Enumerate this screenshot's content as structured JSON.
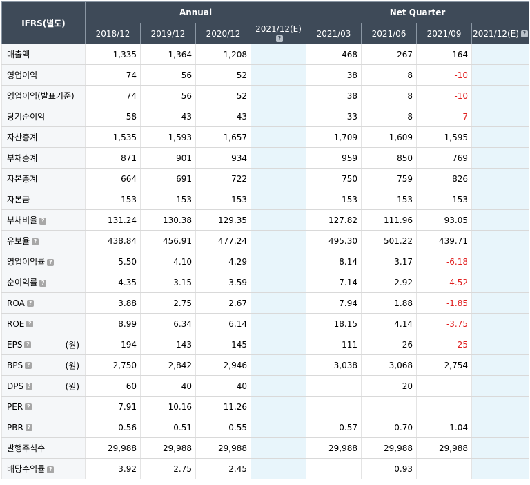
{
  "header": {
    "corner": "IFRS(별도)",
    "groups": [
      "Annual",
      "Net Quarter"
    ],
    "periods": [
      "2018/12",
      "2019/12",
      "2020/12",
      "2021/12(E)",
      "2021/03",
      "2021/06",
      "2021/09",
      "2021/12(E)"
    ],
    "help_glyph": "?"
  },
  "rows": [
    {
      "label": "매출액",
      "help": false,
      "unit": "",
      "values": [
        "1,335",
        "1,364",
        "1,208",
        "",
        "468",
        "267",
        "164",
        ""
      ]
    },
    {
      "label": "영업이익",
      "help": false,
      "unit": "",
      "values": [
        "74",
        "56",
        "52",
        "",
        "38",
        "8",
        "-10",
        ""
      ]
    },
    {
      "label": "영업이익(발표기준)",
      "help": false,
      "unit": "",
      "values": [
        "74",
        "56",
        "52",
        "",
        "38",
        "8",
        "-10",
        ""
      ]
    },
    {
      "label": "당기순이익",
      "help": false,
      "unit": "",
      "values": [
        "58",
        "43",
        "43",
        "",
        "33",
        "8",
        "-7",
        ""
      ]
    },
    {
      "label": "자산총계",
      "help": false,
      "unit": "",
      "values": [
        "1,535",
        "1,593",
        "1,657",
        "",
        "1,709",
        "1,609",
        "1,595",
        ""
      ]
    },
    {
      "label": "부채총계",
      "help": false,
      "unit": "",
      "values": [
        "871",
        "901",
        "934",
        "",
        "959",
        "850",
        "769",
        ""
      ]
    },
    {
      "label": "자본총계",
      "help": false,
      "unit": "",
      "values": [
        "664",
        "691",
        "722",
        "",
        "750",
        "759",
        "826",
        ""
      ]
    },
    {
      "label": "자본금",
      "help": false,
      "unit": "",
      "values": [
        "153",
        "153",
        "153",
        "",
        "153",
        "153",
        "153",
        ""
      ]
    },
    {
      "label": "부채비율",
      "help": true,
      "unit": "",
      "values": [
        "131.24",
        "130.38",
        "129.35",
        "",
        "127.82",
        "111.96",
        "93.05",
        ""
      ]
    },
    {
      "label": "유보율",
      "help": true,
      "unit": "",
      "values": [
        "438.84",
        "456.91",
        "477.24",
        "",
        "495.30",
        "501.22",
        "439.71",
        ""
      ]
    },
    {
      "label": "영업이익률",
      "help": true,
      "unit": "",
      "values": [
        "5.50",
        "4.10",
        "4.29",
        "",
        "8.14",
        "3.17",
        "-6.18",
        ""
      ]
    },
    {
      "label": "순이익률",
      "help": true,
      "unit": "",
      "values": [
        "4.35",
        "3.15",
        "3.59",
        "",
        "7.14",
        "2.92",
        "-4.52",
        ""
      ]
    },
    {
      "label": "ROA",
      "help": true,
      "unit": "",
      "values": [
        "3.88",
        "2.75",
        "2.67",
        "",
        "7.94",
        "1.88",
        "-1.85",
        ""
      ]
    },
    {
      "label": "ROE",
      "help": true,
      "unit": "",
      "values": [
        "8.99",
        "6.34",
        "6.14",
        "",
        "18.15",
        "4.14",
        "-3.75",
        ""
      ]
    },
    {
      "label": "EPS",
      "help": true,
      "unit": "(원)",
      "values": [
        "194",
        "143",
        "145",
        "",
        "111",
        "26",
        "-25",
        ""
      ]
    },
    {
      "label": "BPS",
      "help": true,
      "unit": "(원)",
      "values": [
        "2,750",
        "2,842",
        "2,946",
        "",
        "3,038",
        "3,068",
        "2,754",
        ""
      ]
    },
    {
      "label": "DPS",
      "help": true,
      "unit": "(원)",
      "values": [
        "60",
        "40",
        "40",
        "",
        "",
        "20",
        "",
        ""
      ]
    },
    {
      "label": "PER",
      "help": true,
      "unit": "",
      "values": [
        "7.91",
        "10.16",
        "11.26",
        "",
        "",
        "",
        "",
        ""
      ]
    },
    {
      "label": "PBR",
      "help": true,
      "unit": "",
      "values": [
        "0.56",
        "0.51",
        "0.55",
        "",
        "0.57",
        "0.70",
        "1.04",
        ""
      ]
    },
    {
      "label": "발행주식수",
      "help": false,
      "unit": "",
      "values": [
        "29,988",
        "29,988",
        "29,988",
        "",
        "29,988",
        "29,988",
        "29,988",
        ""
      ]
    },
    {
      "label": "배당수익률",
      "help": true,
      "unit": "",
      "values": [
        "3.92",
        "2.75",
        "2.45",
        "",
        "",
        "0.93",
        "",
        ""
      ]
    }
  ]
}
